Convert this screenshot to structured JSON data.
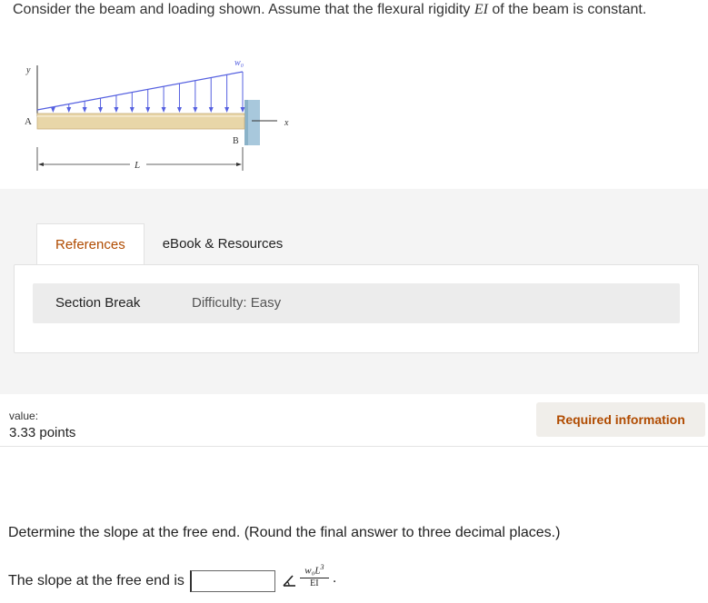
{
  "problem": {
    "intro_before": "Consider the beam and loading shown. Assume that the flexural rigidity ",
    "intro_italic": "EI",
    "intro_after": " of the beam is constant."
  },
  "figure": {
    "label_y": "y",
    "label_A": "A",
    "label_B": "B",
    "label_x": "x",
    "label_w0": "w₀",
    "label_L": "L"
  },
  "tabs": [
    {
      "label": "References",
      "active": true
    },
    {
      "label": "eBook & Resources",
      "active": false
    }
  ],
  "section": {
    "label": "Section Break",
    "difficulty": "Difficulty: Easy"
  },
  "score": {
    "value_label": "value:",
    "points": "3.33 points"
  },
  "required_button": "Required information",
  "question": {
    "text": "Determine the slope at the free end. (Round the final answer to three decimal places.)",
    "answer_prefix": "The slope at the free end is",
    "answer_value": "",
    "unit_numerator": "w₀L",
    "unit_numerator_exp": "3",
    "unit_denominator": "EI",
    "unit_suffix": "."
  },
  "colors": {
    "load_arrow": "#5560e0",
    "beam": "#e8d6a8",
    "wall": "#a8c8dc",
    "accent": "#b04b00"
  }
}
